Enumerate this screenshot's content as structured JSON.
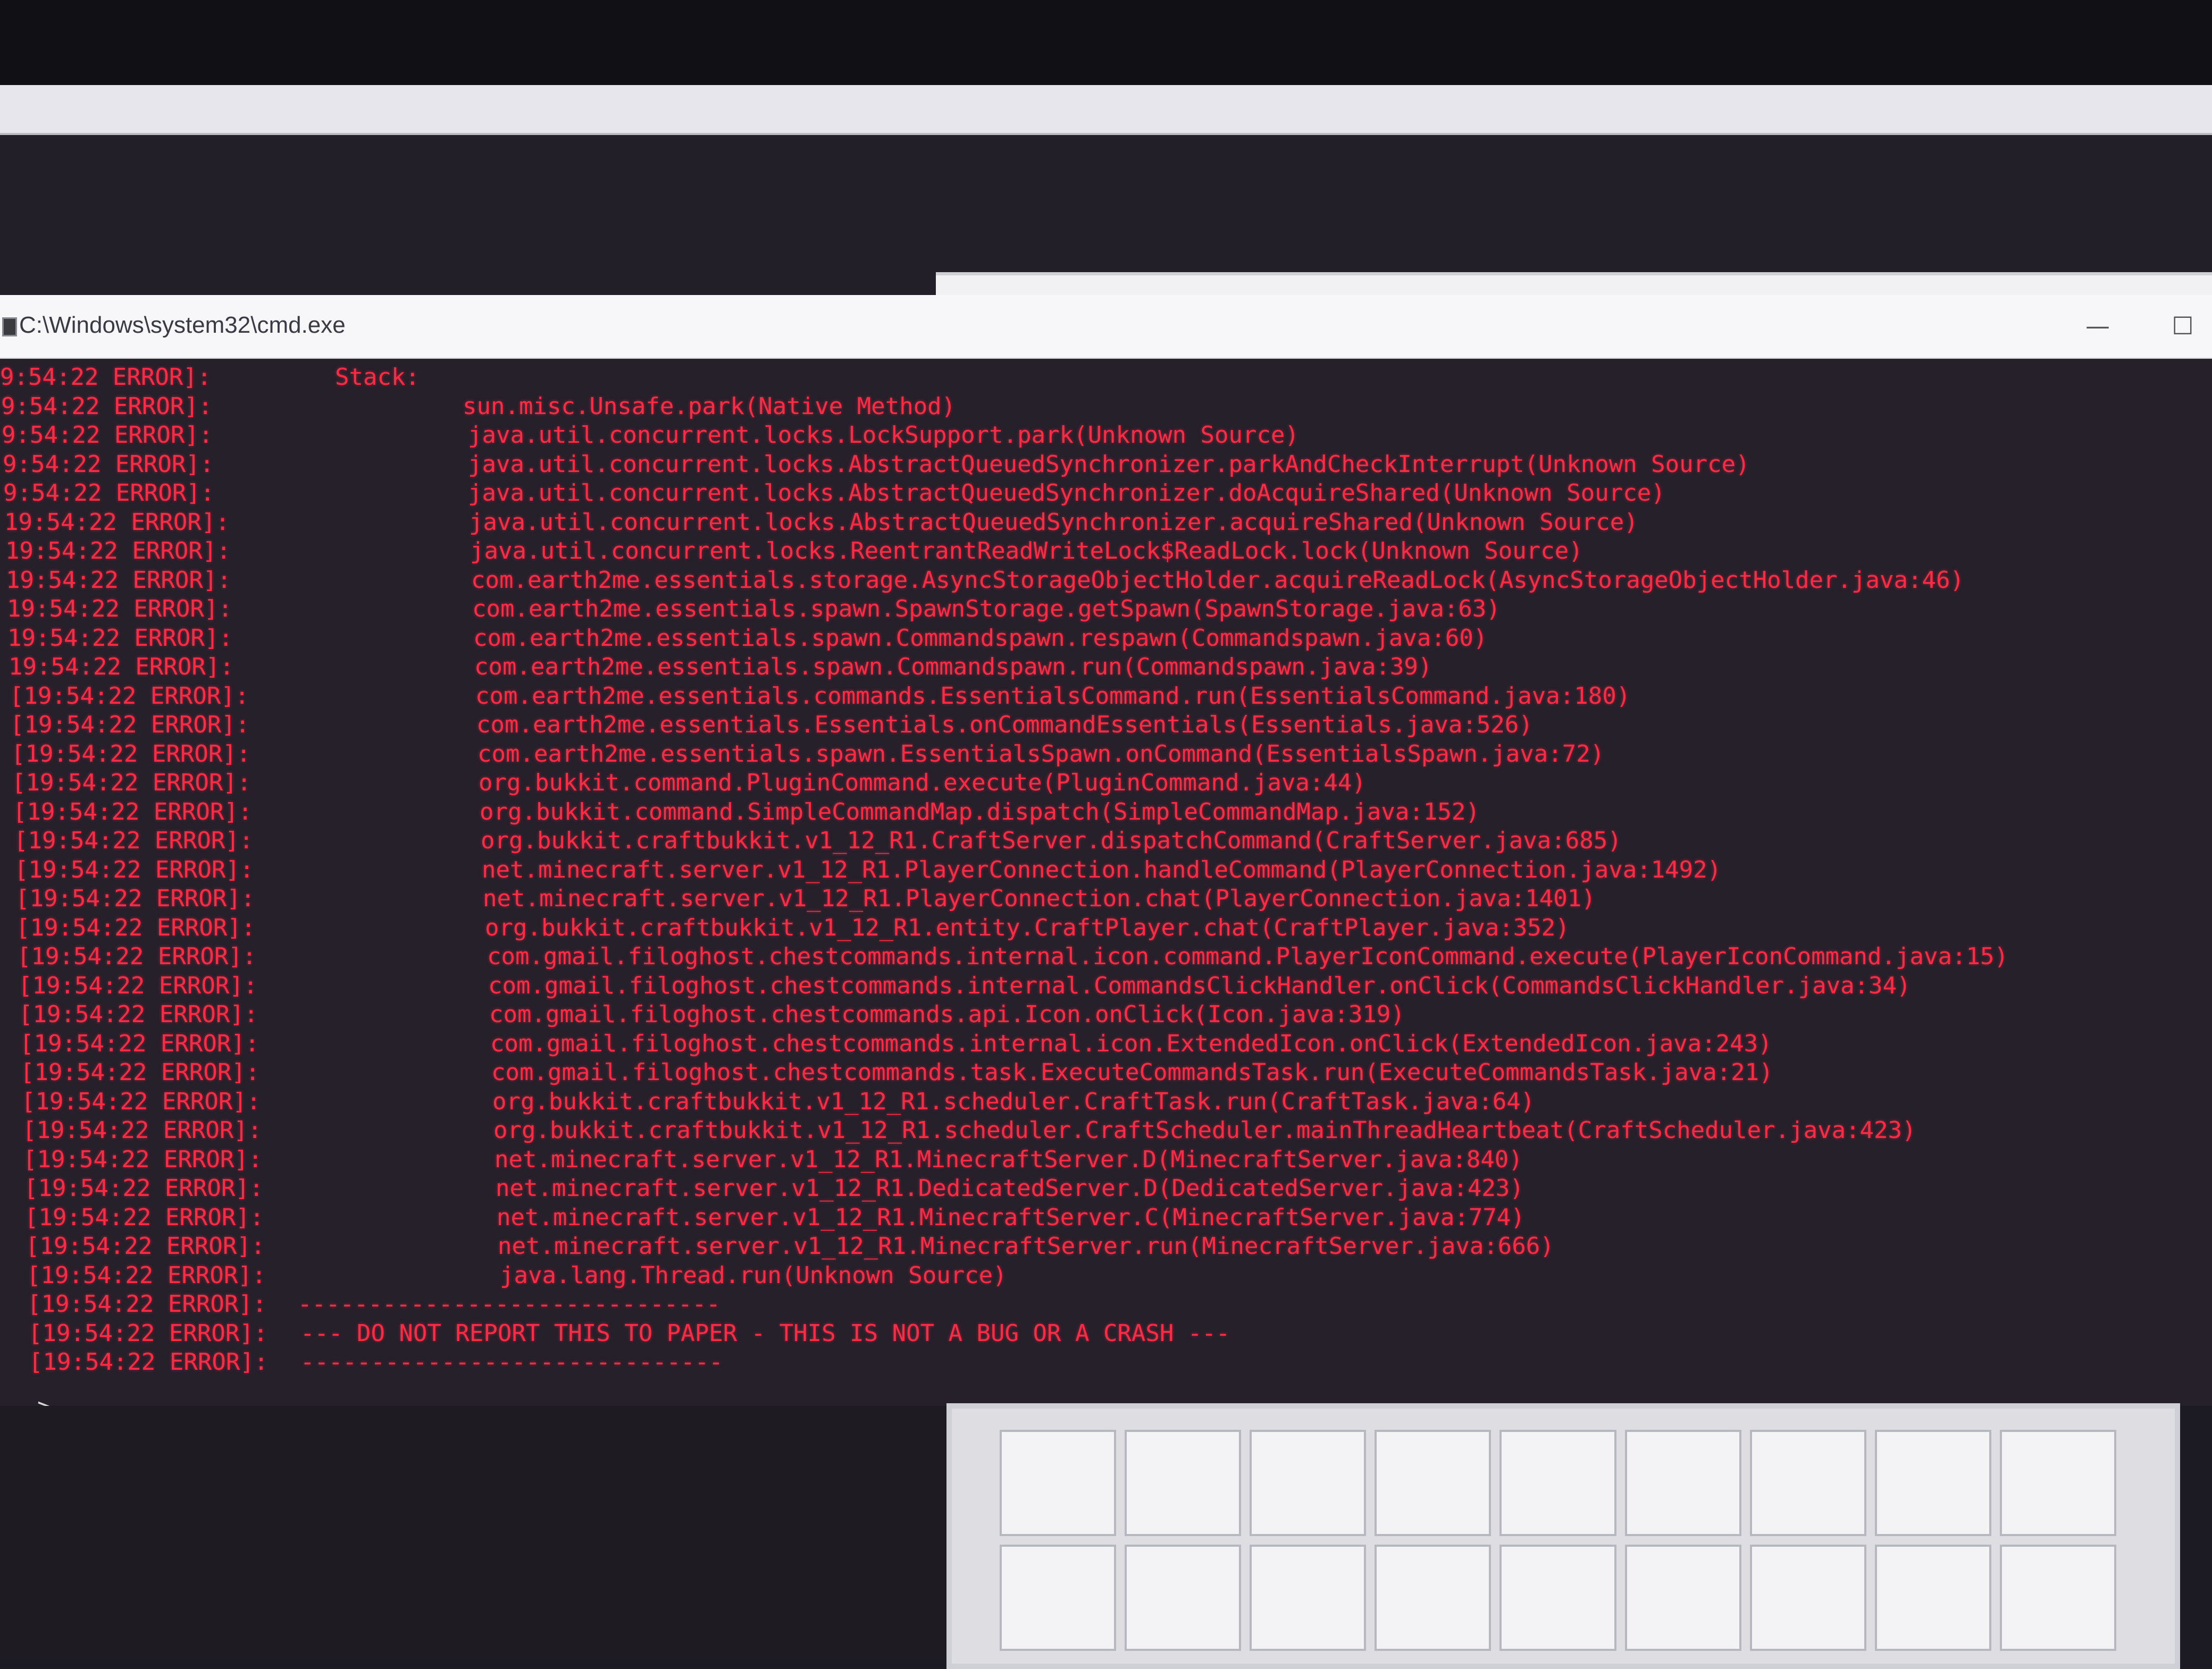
{
  "window": {
    "title": "C:\\Windows\\system32\\cmd.exe",
    "minimize_glyph": "—",
    "maximize_glyph": "☐"
  },
  "console": {
    "lines": [
      {
        "ts": "9:54:22 ERROR]:",
        "msg": "Stack:"
      },
      {
        "ts": "9:54:22 ERROR]:",
        "msg": "sun.misc.Unsafe.park(Native Method)"
      },
      {
        "ts": "9:54:22 ERROR]:",
        "msg": "java.util.concurrent.locks.LockSupport.park(Unknown Source)"
      },
      {
        "ts": "9:54:22 ERROR]:",
        "msg": "java.util.concurrent.locks.AbstractQueuedSynchronizer.parkAndCheckInterrupt(Unknown Source)"
      },
      {
        "ts": "9:54:22 ERROR]:",
        "msg": "java.util.concurrent.locks.AbstractQueuedSynchronizer.doAcquireShared(Unknown Source)"
      },
      {
        "ts": "19:54:22 ERROR]:",
        "msg": "java.util.concurrent.locks.AbstractQueuedSynchronizer.acquireShared(Unknown Source)"
      },
      {
        "ts": "19:54:22 ERROR]:",
        "msg": "java.util.concurrent.locks.ReentrantReadWriteLock$ReadLock.lock(Unknown Source)"
      },
      {
        "ts": "19:54:22 ERROR]:",
        "msg": "com.earth2me.essentials.storage.AsyncStorageObjectHolder.acquireReadLock(AsyncStorageObjectHolder.java:46)"
      },
      {
        "ts": "19:54:22 ERROR]:",
        "msg": "com.earth2me.essentials.spawn.SpawnStorage.getSpawn(SpawnStorage.java:63)"
      },
      {
        "ts": "19:54:22 ERROR]:",
        "msg": "com.earth2me.essentials.spawn.Commandspawn.respawn(Commandspawn.java:60)"
      },
      {
        "ts": "19:54:22 ERROR]:",
        "msg": "com.earth2me.essentials.spawn.Commandspawn.run(Commandspawn.java:39)"
      },
      {
        "ts": "[19:54:22 ERROR]:",
        "msg": "com.earth2me.essentials.commands.EssentialsCommand.run(EssentialsCommand.java:180)"
      },
      {
        "ts": "[19:54:22 ERROR]:",
        "msg": "com.earth2me.essentials.Essentials.onCommandEssentials(Essentials.java:526)"
      },
      {
        "ts": "[19:54:22 ERROR]:",
        "msg": "com.earth2me.essentials.spawn.EssentialsSpawn.onCommand(EssentialsSpawn.java:72)"
      },
      {
        "ts": "[19:54:22 ERROR]:",
        "msg": "org.bukkit.command.PluginCommand.execute(PluginCommand.java:44)"
      },
      {
        "ts": "[19:54:22 ERROR]:",
        "msg": "org.bukkit.command.SimpleCommandMap.dispatch(SimpleCommandMap.java:152)"
      },
      {
        "ts": "[19:54:22 ERROR]:",
        "msg": "org.bukkit.craftbukkit.v1_12_R1.CraftServer.dispatchCommand(CraftServer.java:685)"
      },
      {
        "ts": "[19:54:22 ERROR]:",
        "msg": "net.minecraft.server.v1_12_R1.PlayerConnection.handleCommand(PlayerConnection.java:1492)"
      },
      {
        "ts": "[19:54:22 ERROR]:",
        "msg": "net.minecraft.server.v1_12_R1.PlayerConnection.chat(PlayerConnection.java:1401)"
      },
      {
        "ts": "[19:54:22 ERROR]:",
        "msg": "org.bukkit.craftbukkit.v1_12_R1.entity.CraftPlayer.chat(CraftPlayer.java:352)"
      },
      {
        "ts": "[19:54:22 ERROR]:",
        "msg": "com.gmail.filoghost.chestcommands.internal.icon.command.PlayerIconCommand.execute(PlayerIconCommand.java:15)"
      },
      {
        "ts": "[19:54:22 ERROR]:",
        "msg": "com.gmail.filoghost.chestcommands.internal.CommandsClickHandler.onClick(CommandsClickHandler.java:34)"
      },
      {
        "ts": "[19:54:22 ERROR]:",
        "msg": "com.gmail.filoghost.chestcommands.api.Icon.onClick(Icon.java:319)"
      },
      {
        "ts": "[19:54:22 ERROR]:",
        "msg": "com.gmail.filoghost.chestcommands.internal.icon.ExtendedIcon.onClick(ExtendedIcon.java:243)"
      },
      {
        "ts": "[19:54:22 ERROR]:",
        "msg": "com.gmail.filoghost.chestcommands.task.ExecuteCommandsTask.run(ExecuteCommandsTask.java:21)"
      },
      {
        "ts": "[19:54:22 ERROR]:",
        "msg": "org.bukkit.craftbukkit.v1_12_R1.scheduler.CraftTask.run(CraftTask.java:64)"
      },
      {
        "ts": "[19:54:22 ERROR]:",
        "msg": "org.bukkit.craftbukkit.v1_12_R1.scheduler.CraftScheduler.mainThreadHeartbeat(CraftScheduler.java:423)"
      },
      {
        "ts": "[19:54:22 ERROR]:",
        "msg": "net.minecraft.server.v1_12_R1.MinecraftServer.D(MinecraftServer.java:840)"
      },
      {
        "ts": "[19:54:22 ERROR]:",
        "msg": "net.minecraft.server.v1_12_R1.DedicatedServer.D(DedicatedServer.java:423)"
      },
      {
        "ts": "[19:54:22 ERROR]:",
        "msg": "net.minecraft.server.v1_12_R1.MinecraftServer.C(MinecraftServer.java:774)"
      },
      {
        "ts": "[19:54:22 ERROR]:",
        "msg": "net.minecraft.server.v1_12_R1.MinecraftServer.run(MinecraftServer.java:666)"
      },
      {
        "ts": "[19:54:22 ERROR]:",
        "msg": "java.lang.Thread.run(Unknown Source)"
      },
      {
        "ts": "[19:54:22 ERROR]:",
        "msg": "------------------------------"
      },
      {
        "ts": "[19:54:22 ERROR]:",
        "msg": "--- DO NOT REPORT THIS TO PAPER - THIS IS NOT A BUG OR A CRASH ---"
      },
      {
        "ts": "[19:54:22 ERROR]:",
        "msg": "------------------------------"
      }
    ],
    "prompt": ">"
  }
}
